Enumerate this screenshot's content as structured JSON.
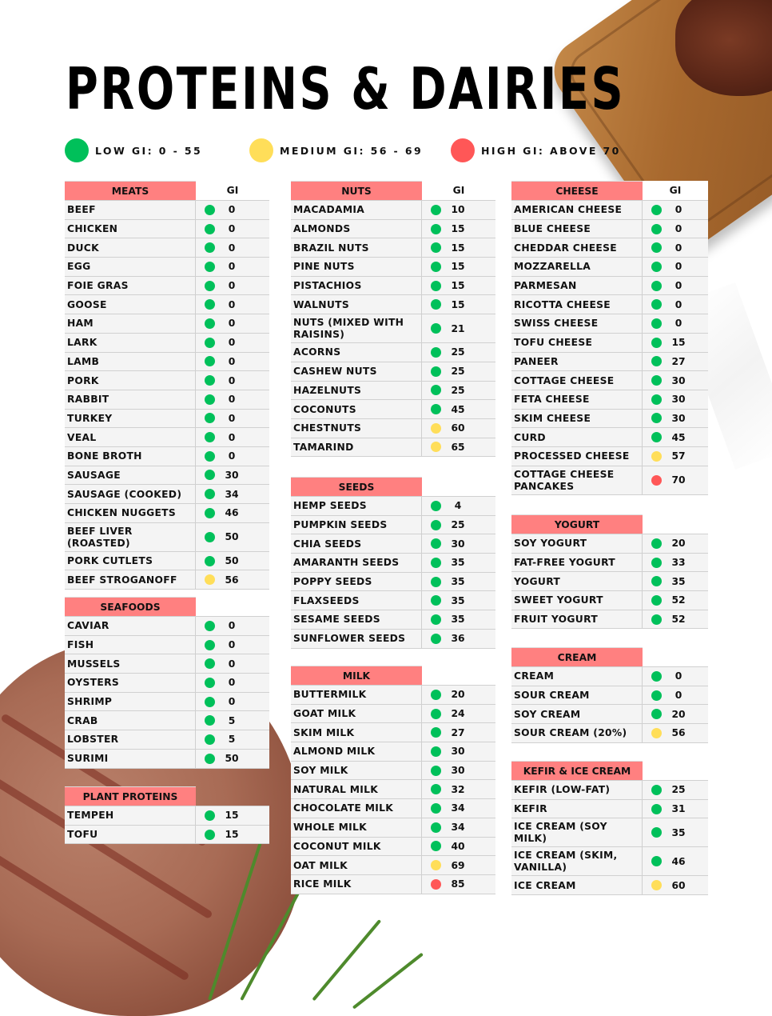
{
  "title": "PROTEINS & DAIRIES",
  "colors": {
    "low": "#00c05a",
    "medium": "#ffde59",
    "high": "#ff5757",
    "header_bg": "#ff8080",
    "row_bg": "#f4f4f4"
  },
  "legend": [
    {
      "level": "low",
      "label": "LOW GI: 0 - 55"
    },
    {
      "level": "medium",
      "label": "MEDIUM GI: 56 - 69"
    },
    {
      "level": "high",
      "label": "HIGH GI: ABOVE 70"
    }
  ],
  "gi_header": "GI",
  "tables": {
    "meats": {
      "title": "MEATS",
      "show_gi": true,
      "rows": [
        {
          "name": "BEEF",
          "gi": "0",
          "level": "low"
        },
        {
          "name": "CHICKEN",
          "gi": "0",
          "level": "low"
        },
        {
          "name": "DUCK",
          "gi": "0",
          "level": "low"
        },
        {
          "name": "EGG",
          "gi": "0",
          "level": "low"
        },
        {
          "name": "FOIE GRAS",
          "gi": "0",
          "level": "low"
        },
        {
          "name": "GOOSE",
          "gi": "0",
          "level": "low"
        },
        {
          "name": "HAM",
          "gi": "0",
          "level": "low"
        },
        {
          "name": "LARK",
          "gi": "0",
          "level": "low"
        },
        {
          "name": "LAMB",
          "gi": "0",
          "level": "low"
        },
        {
          "name": "PORK",
          "gi": "0",
          "level": "low"
        },
        {
          "name": "RABBIT",
          "gi": "0",
          "level": "low"
        },
        {
          "name": "TURKEY",
          "gi": "0",
          "level": "low"
        },
        {
          "name": "VEAL",
          "gi": "0",
          "level": "low"
        },
        {
          "name": "BONE BROTH",
          "gi": "0",
          "level": "low"
        },
        {
          "name": "SAUSAGE",
          "gi": "30",
          "level": "low"
        },
        {
          "name": "SAUSAGE (COOKED)",
          "gi": "34",
          "level": "low"
        },
        {
          "name": "CHICKEN NUGGETS",
          "gi": "46",
          "level": "low"
        },
        {
          "name": "BEEF LIVER (ROASTED)",
          "gi": "50",
          "level": "low"
        },
        {
          "name": "PORK CUTLETS",
          "gi": "50",
          "level": "low"
        },
        {
          "name": "BEEF STROGANOFF",
          "gi": "56",
          "level": "medium"
        }
      ]
    },
    "seafoods": {
      "title": "SEAFOODS",
      "show_gi": false,
      "rows": [
        {
          "name": "CAVIAR",
          "gi": "0",
          "level": "low"
        },
        {
          "name": "FISH",
          "gi": "0",
          "level": "low"
        },
        {
          "name": "MUSSELS",
          "gi": "0",
          "level": "low"
        },
        {
          "name": "OYSTERS",
          "gi": "0",
          "level": "low"
        },
        {
          "name": "SHRIMP",
          "gi": "0",
          "level": "low"
        },
        {
          "name": "CRAB",
          "gi": "5",
          "level": "low"
        },
        {
          "name": "LOBSTER",
          "gi": "5",
          "level": "low"
        },
        {
          "name": "SURIMI",
          "gi": "50",
          "level": "low"
        }
      ]
    },
    "plant_proteins": {
      "title": "PLANT PROTEINS",
      "show_gi": false,
      "rows": [
        {
          "name": "TEMPEH",
          "gi": "15",
          "level": "low"
        },
        {
          "name": "TOFU",
          "gi": "15",
          "level": "low"
        }
      ]
    },
    "nuts": {
      "title": "NUTS",
      "show_gi": true,
      "rows": [
        {
          "name": "MACADAMIA",
          "gi": "10",
          "level": "low"
        },
        {
          "name": "ALMONDS",
          "gi": "15",
          "level": "low"
        },
        {
          "name": "BRAZIL NUTS",
          "gi": "15",
          "level": "low"
        },
        {
          "name": "PINE NUTS",
          "gi": "15",
          "level": "low"
        },
        {
          "name": "PISTACHIOS",
          "gi": "15",
          "level": "low"
        },
        {
          "name": "WALNUTS",
          "gi": "15",
          "level": "low"
        },
        {
          "name": "NUTS (MIXED WITH RAISINS)",
          "gi": "21",
          "level": "low"
        },
        {
          "name": "ACORNS",
          "gi": "25",
          "level": "low"
        },
        {
          "name": "CASHEW NUTS",
          "gi": "25",
          "level": "low"
        },
        {
          "name": "HAZELNUTS",
          "gi": "25",
          "level": "low"
        },
        {
          "name": "COCONUTS",
          "gi": "45",
          "level": "low"
        },
        {
          "name": "CHESTNUTS",
          "gi": "60",
          "level": "medium"
        },
        {
          "name": "TAMARIND",
          "gi": "65",
          "level": "medium"
        }
      ]
    },
    "seeds": {
      "title": "SEEDS",
      "show_gi": false,
      "rows": [
        {
          "name": "HEMP SEEDS",
          "gi": "4",
          "level": "low"
        },
        {
          "name": "PUMPKIN SEEDS",
          "gi": "25",
          "level": "low"
        },
        {
          "name": "CHIA SEEDS",
          "gi": "30",
          "level": "low"
        },
        {
          "name": "AMARANTH SEEDS",
          "gi": "35",
          "level": "low"
        },
        {
          "name": "POPPY SEEDS",
          "gi": "35",
          "level": "low"
        },
        {
          "name": "FLAXSEEDS",
          "gi": "35",
          "level": "low"
        },
        {
          "name": "SESAME SEEDS",
          "gi": "35",
          "level": "low"
        },
        {
          "name": "SUNFLOWER SEEDS",
          "gi": "36",
          "level": "low"
        }
      ]
    },
    "milk": {
      "title": "MILK",
      "show_gi": false,
      "rows": [
        {
          "name": "BUTTERMILK",
          "gi": "20",
          "level": "low"
        },
        {
          "name": "GOAT MILK",
          "gi": "24",
          "level": "low"
        },
        {
          "name": "SKIM MILK",
          "gi": "27",
          "level": "low"
        },
        {
          "name": "ALMOND MILK",
          "gi": "30",
          "level": "low"
        },
        {
          "name": "SOY MILK",
          "gi": "30",
          "level": "low"
        },
        {
          "name": "NATURAL MILK",
          "gi": "32",
          "level": "low"
        },
        {
          "name": "CHOCOLATE MILK",
          "gi": "34",
          "level": "low"
        },
        {
          "name": "WHOLE MILK",
          "gi": "34",
          "level": "low"
        },
        {
          "name": "COCONUT MILK",
          "gi": "40",
          "level": "low"
        },
        {
          "name": "OAT MILK",
          "gi": "69",
          "level": "medium"
        },
        {
          "name": "RICE MILK",
          "gi": "85",
          "level": "high"
        }
      ]
    },
    "cheese": {
      "title": "CHEESE",
      "show_gi": true,
      "rows": [
        {
          "name": "AMERICAN CHEESE",
          "gi": "0",
          "level": "low"
        },
        {
          "name": "BLUE CHEESE",
          "gi": "0",
          "level": "low"
        },
        {
          "name": "CHEDDAR CHEESE",
          "gi": "0",
          "level": "low"
        },
        {
          "name": "MOZZARELLA",
          "gi": "0",
          "level": "low"
        },
        {
          "name": "PARMESAN",
          "gi": "0",
          "level": "low"
        },
        {
          "name": "RICOTTA CHEESE",
          "gi": "0",
          "level": "low"
        },
        {
          "name": "SWISS CHEESE",
          "gi": "0",
          "level": "low"
        },
        {
          "name": "TOFU CHEESE",
          "gi": "15",
          "level": "low"
        },
        {
          "name": "PANEER",
          "gi": "27",
          "level": "low"
        },
        {
          "name": "COTTAGE CHEESE",
          "gi": "30",
          "level": "low"
        },
        {
          "name": "FETA CHEESE",
          "gi": "30",
          "level": "low"
        },
        {
          "name": "SKIM CHEESE",
          "gi": "30",
          "level": "low"
        },
        {
          "name": "CURD",
          "gi": "45",
          "level": "low"
        },
        {
          "name": "PROCESSED CHEESE",
          "gi": "57",
          "level": "medium"
        },
        {
          "name": "COTTAGE CHEESE PANCAKES",
          "gi": "70",
          "level": "high"
        }
      ]
    },
    "yogurt": {
      "title": "YOGURT",
      "show_gi": false,
      "rows": [
        {
          "name": "SOY YOGURT",
          "gi": "20",
          "level": "low"
        },
        {
          "name": "FAT-FREE YOGURT",
          "gi": "33",
          "level": "low"
        },
        {
          "name": "YOGURT",
          "gi": "35",
          "level": "low"
        },
        {
          "name": "SWEET YOGURT",
          "gi": "52",
          "level": "low"
        },
        {
          "name": "FRUIT YOGURT",
          "gi": "52",
          "level": "low"
        }
      ]
    },
    "cream": {
      "title": "CREAM",
      "show_gi": false,
      "rows": [
        {
          "name": "CREAM",
          "gi": "0",
          "level": "low"
        },
        {
          "name": "SOUR CREAM",
          "gi": "0",
          "level": "low"
        },
        {
          "name": "SOY CREAM",
          "gi": "20",
          "level": "low"
        },
        {
          "name": "SOUR CREAM (20%)",
          "gi": "56",
          "level": "medium"
        }
      ]
    },
    "kefir_ice_cream": {
      "title": "KEFIR & ICE CREAM",
      "show_gi": false,
      "rows": [
        {
          "name": "KEFIR (LOW-FAT)",
          "gi": "25",
          "level": "low"
        },
        {
          "name": "KEFIR",
          "gi": "31",
          "level": "low"
        },
        {
          "name": "ICE CREAM (SOY MILK)",
          "gi": "35",
          "level": "low"
        },
        {
          "name": "ICE CREAM (SKIM, VANILLA)",
          "gi": "46",
          "level": "low"
        },
        {
          "name": "ICE CREAM",
          "gi": "60",
          "level": "medium"
        }
      ]
    }
  }
}
